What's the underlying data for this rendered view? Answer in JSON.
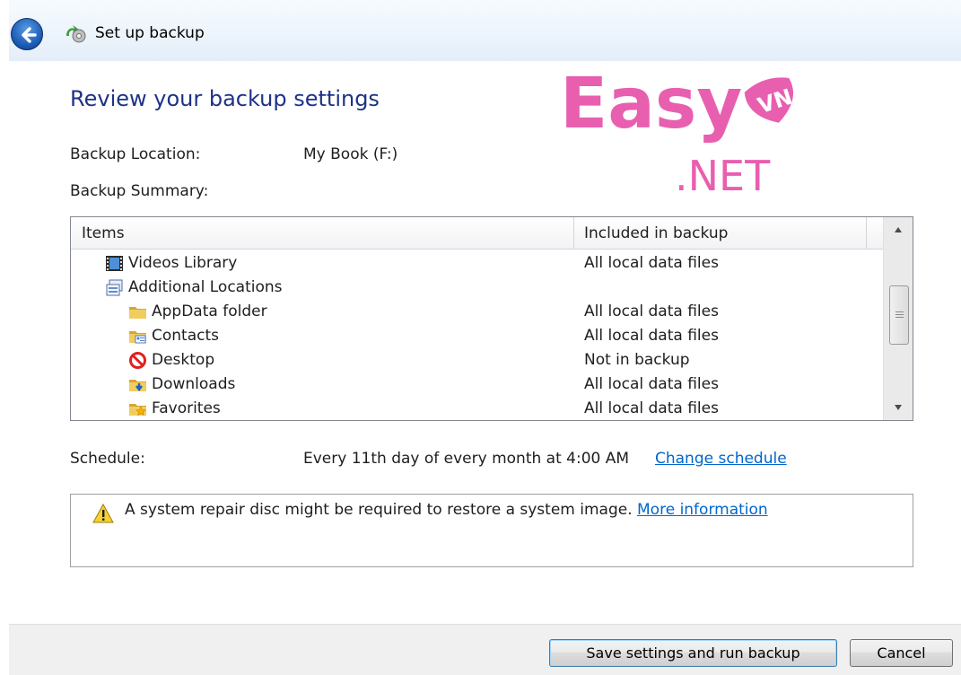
{
  "window": {
    "title": "Set up backup"
  },
  "heading": "Review your backup settings",
  "location": {
    "label": "Backup Location:",
    "value": "My Book (F:)"
  },
  "summary": {
    "label": "Backup Summary:",
    "columns": [
      "Items",
      "Included in backup"
    ],
    "rows": [
      {
        "name": "Videos Library",
        "value": "All local data files",
        "icon": "videos-library-icon"
      },
      {
        "name": "Additional Locations",
        "value": "",
        "icon": "additional-locations-icon"
      },
      {
        "name": "AppData folder",
        "value": "All local data files",
        "icon": "folder-icon"
      },
      {
        "name": "Contacts",
        "value": "All local data files",
        "icon": "contacts-folder-icon"
      },
      {
        "name": "Desktop",
        "value": "Not in backup",
        "icon": "not-included-icon"
      },
      {
        "name": "Downloads",
        "value": "All local data files",
        "icon": "downloads-folder-icon"
      },
      {
        "name": "Favorites",
        "value": "All local data files",
        "icon": "favorites-folder-icon"
      }
    ]
  },
  "schedule": {
    "label": "Schedule:",
    "value": "Every 11th day of every month at 4:00 AM",
    "link": "Change schedule"
  },
  "info": {
    "text": "A system repair disc might be required to restore a system image.",
    "link": "More information"
  },
  "buttons": {
    "primary": "Save settings and run backup",
    "cancel": "Cancel"
  },
  "watermark": {
    "line1": "Easy",
    "badge": "VN",
    "line2": ".NET"
  },
  "colors": {
    "heading": "#1e3287",
    "link": "#0066cc",
    "watermark": "#e85fb0"
  }
}
